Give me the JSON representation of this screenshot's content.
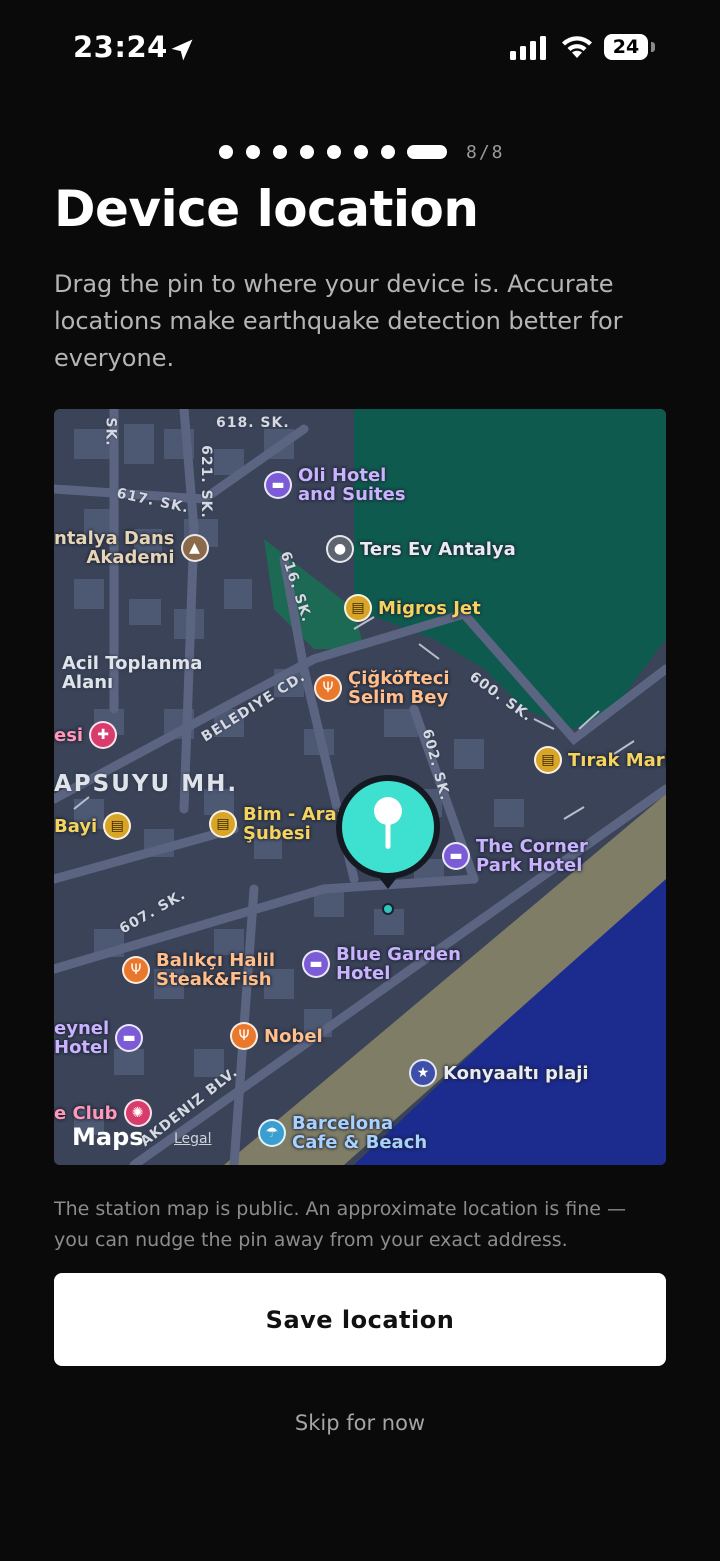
{
  "status_bar": {
    "time": "23:24",
    "battery": "24"
  },
  "onboarding": {
    "step_count": "8/8",
    "total_steps": 8,
    "current_step": 8
  },
  "page": {
    "title": "Device location",
    "description": "Drag the pin to where your device is. Accurate locations make earthquake detection better for everyone.",
    "note": "The station map is public. An approximate location is fine — you can nudge the pin away from your exact address."
  },
  "map": {
    "attribution": "Maps",
    "legal": "Legal",
    "district": "APSUYU MH.",
    "streets": {
      "s618": "618. SK.",
      "s617": "617. SK.",
      "s621": "621. SK.",
      "s616": "616. SK.",
      "s600": "600. SK.",
      "s602": "602. SK.",
      "s607": "607. SK.",
      "belediye": "BELEDIYE CD.",
      "akdeniz": "AKDENIZ BLV.",
      "edge_sk": "SK."
    },
    "places": {
      "oli_hotel": "Oli Hotel\nand Suites",
      "dans_akademi": "ntalya Dans\nAkademi",
      "ters_ev": "Ters Ev Antalya",
      "migros": "Migros Jet",
      "acil": "Acil Toplanma\nAlanı",
      "cigkofteci": "Çiğköfteci\nSelim Bey",
      "esi": "esi",
      "tirak": "Tırak Mark",
      "bayi": "Bayi",
      "bim": "Bim - Arap\nŞubesi",
      "corner": "The Corner\nPark Hotel",
      "balikci": "Balıkçı Halil\nSteak&Fish",
      "blue_garden": "Blue Garden\nHotel",
      "eynel": "eynel\nHotel",
      "nobel": "Nobel",
      "konyaalti": "Konyaaltı plaji",
      "club": "e Club",
      "barcelona": "Barcelona\nCafe & Beach"
    }
  },
  "actions": {
    "save_label": "Save location",
    "skip_label": "Skip for now"
  },
  "colors": {
    "accent": "#3ee0cf",
    "background": "#0a0a0a",
    "map_land": "#3a4358",
    "map_park": "#0f5a4f",
    "map_sea": "#1c2b8e",
    "map_beach": "#7f7d66"
  }
}
